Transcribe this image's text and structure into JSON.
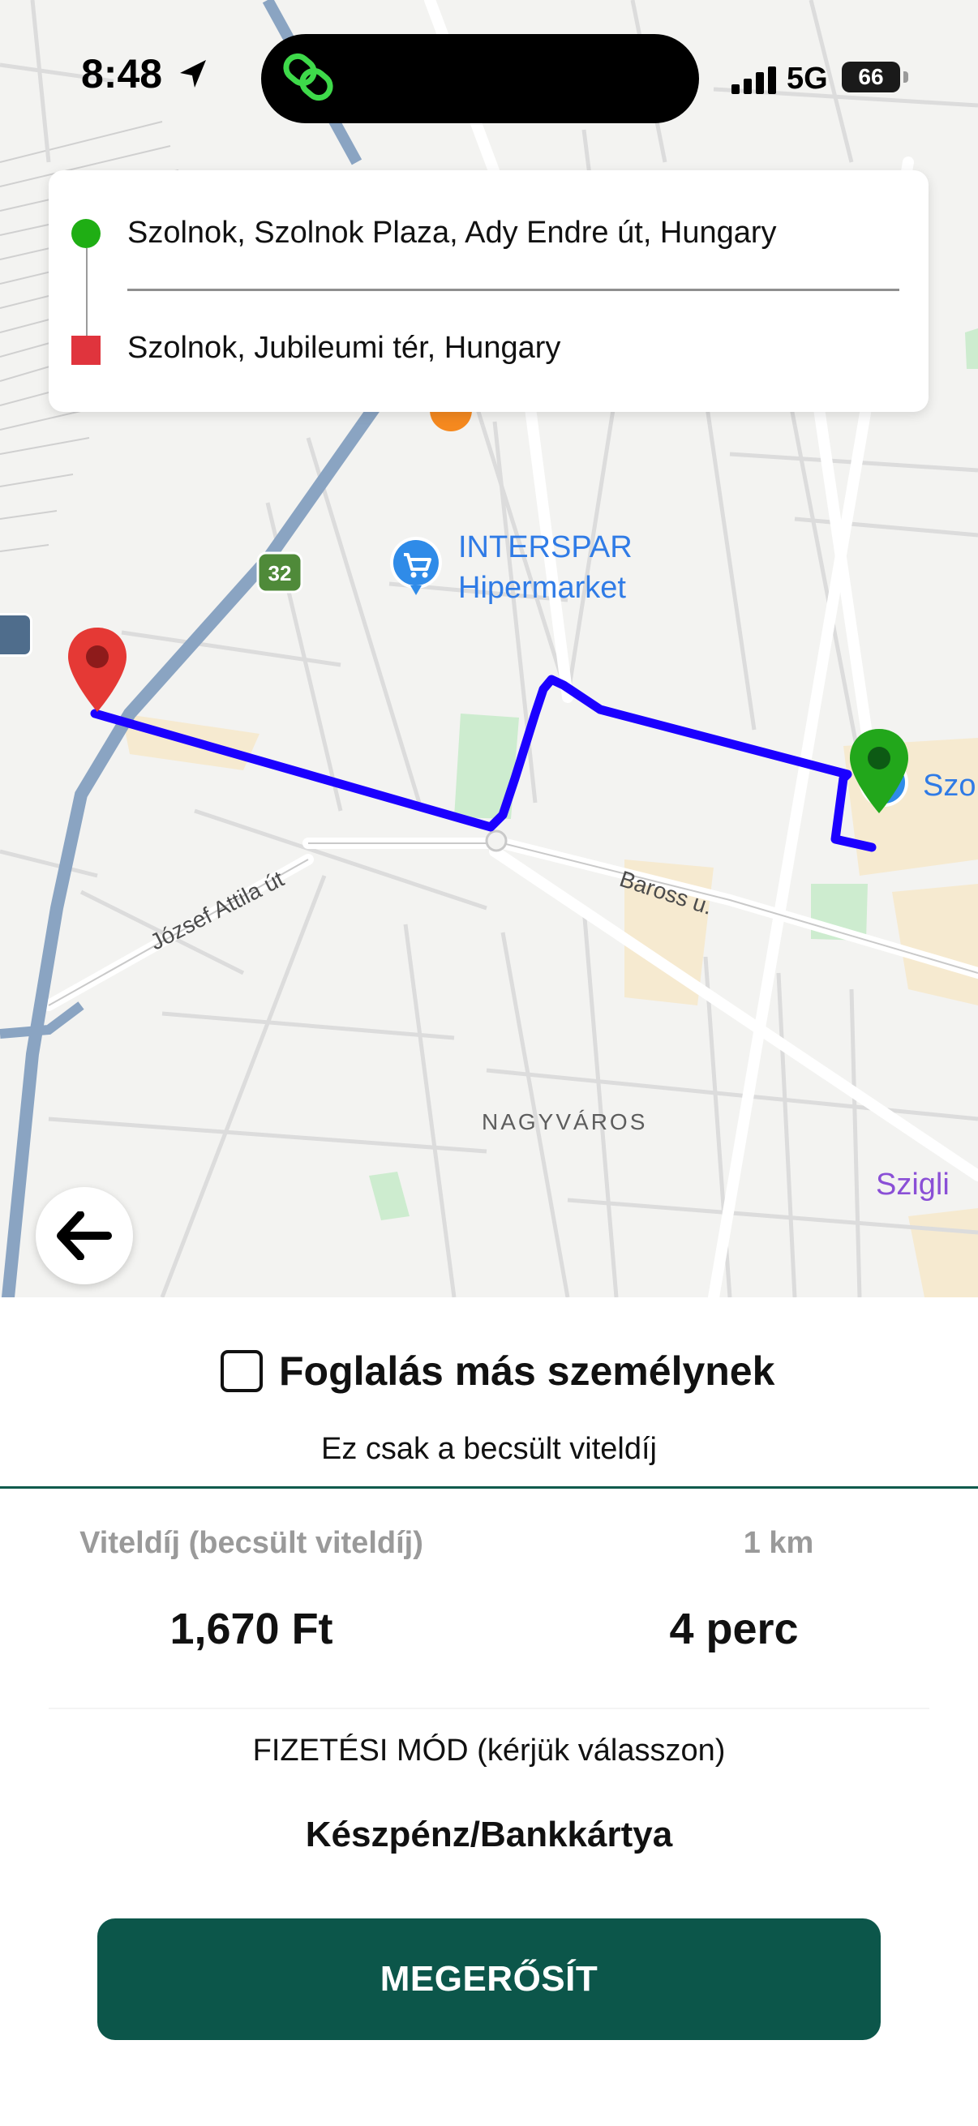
{
  "status_bar": {
    "time": "8:48",
    "network": "5G",
    "battery": "66",
    "icons": [
      "location-arrow-icon",
      "app-link-icon",
      "signal-bars-icon",
      "battery-icon"
    ]
  },
  "route": {
    "origin": "Szolnok, Szolnok Plaza, Ady Endre út, Hungary",
    "destination": "Szolnok, Jubileumi tér, Hungary",
    "line_color": "#1b00ff",
    "origin_color": "#1fae14",
    "destination_color": "#e0343d"
  },
  "map": {
    "poi": [
      "INTERSPAR",
      "Hipermarket"
    ],
    "road_shield": "32",
    "streets": [
      "József Attila út",
      "Baross u."
    ],
    "district": "NAGYVÁROS",
    "edge_labels": [
      "Szigli",
      "Szo"
    ]
  },
  "booking": {
    "checkbox_label": "Foglalás más személynek",
    "checked": false,
    "estimate_note": "Ez csak a becsült viteldíj"
  },
  "fare": {
    "label": "Viteldíj (becsült viteldíj)",
    "value": "1,670 Ft",
    "distance": "1 km",
    "duration": "4 perc"
  },
  "payment": {
    "heading": "FIZETÉSI MÓD (kérjük válasszon)",
    "method": "Készpénz/Bankkártya"
  },
  "confirm": {
    "label": "MEGERŐSÍT",
    "color": "#0c564a"
  }
}
